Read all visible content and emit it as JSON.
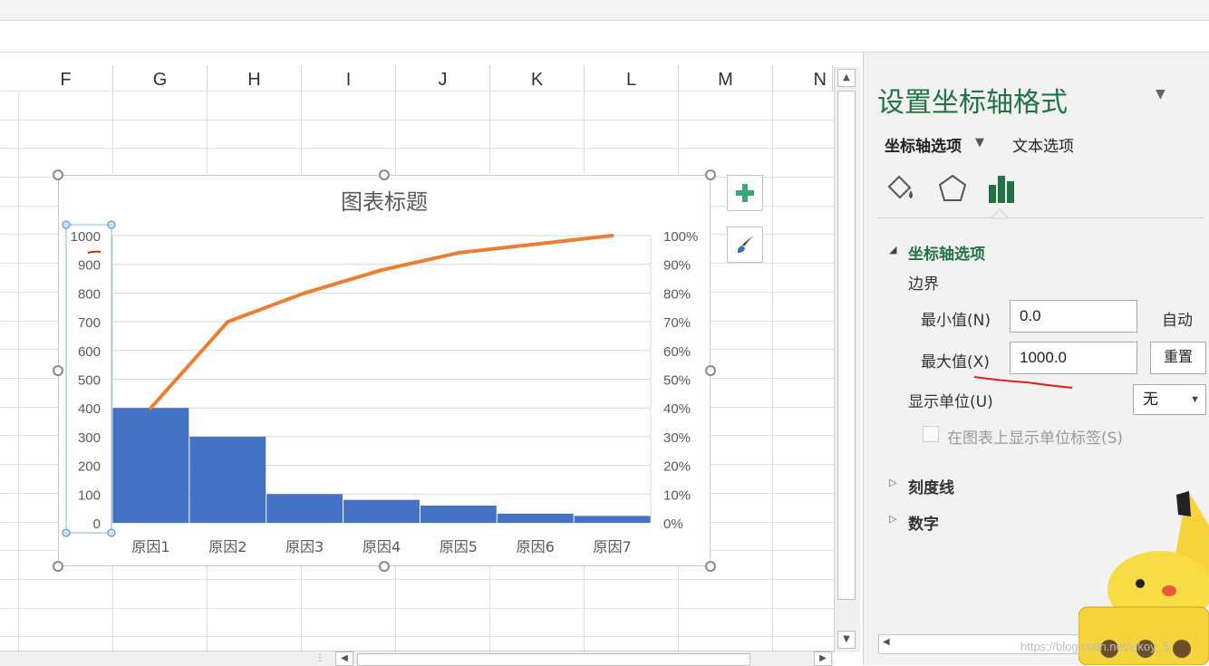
{
  "columns": [
    "F",
    "G",
    "H",
    "I",
    "J",
    "K",
    "L",
    "M",
    "N"
  ],
  "chart": {
    "title": "图表标题",
    "add_button_icon": "plus-icon",
    "style_button_icon": "brush-icon"
  },
  "chart_data": {
    "type": "bar",
    "title": "图表标题",
    "categories": [
      "原因1",
      "原因2",
      "原因3",
      "原因4",
      "原因5",
      "原因6",
      "原因7"
    ],
    "series": [
      {
        "type": "bar",
        "values": [
          400,
          300,
          100,
          80,
          60,
          32,
          24
        ],
        "color": "#4472c4"
      },
      {
        "type": "line",
        "axis": "secondary",
        "values": [
          0.4,
          0.7,
          0.8,
          0.88,
          0.94,
          0.97,
          1.0
        ],
        "color": "#ed7d31"
      }
    ],
    "y_ticks": [
      "0",
      "100",
      "200",
      "300",
      "400",
      "500",
      "600",
      "700",
      "800",
      "900",
      "1000"
    ],
    "y2_ticks": [
      "0%",
      "10%",
      "20%",
      "30%",
      "40%",
      "50%",
      "60%",
      "70%",
      "80%",
      "90%",
      "100%"
    ],
    "ylim": [
      0,
      1000
    ],
    "y2lim": [
      0,
      1
    ],
    "grid": true
  },
  "pane": {
    "title": "设置坐标轴格式",
    "tab_axis_options": "坐标轴选项",
    "tab_text_options": "文本选项",
    "icons": [
      "fill-bucket-icon",
      "pentagon-icon",
      "bar-chart-icon"
    ],
    "section_axis_options": "坐标轴选项",
    "bounds_label": "边界",
    "min_label": "最小值(N)",
    "min_value": "0.0",
    "min_auto": "自动",
    "max_label": "最大值(X)",
    "max_value": "1000.0",
    "max_reset": "重置",
    "display_units_label": "显示单位(U)",
    "display_units_value": "无",
    "show_units_label": "在图表上显示单位标签(S)",
    "section_ticks": "刻度线",
    "section_numbers": "数字"
  },
  "watermark": "https://blog.csdn.net/zjkoy_5"
}
